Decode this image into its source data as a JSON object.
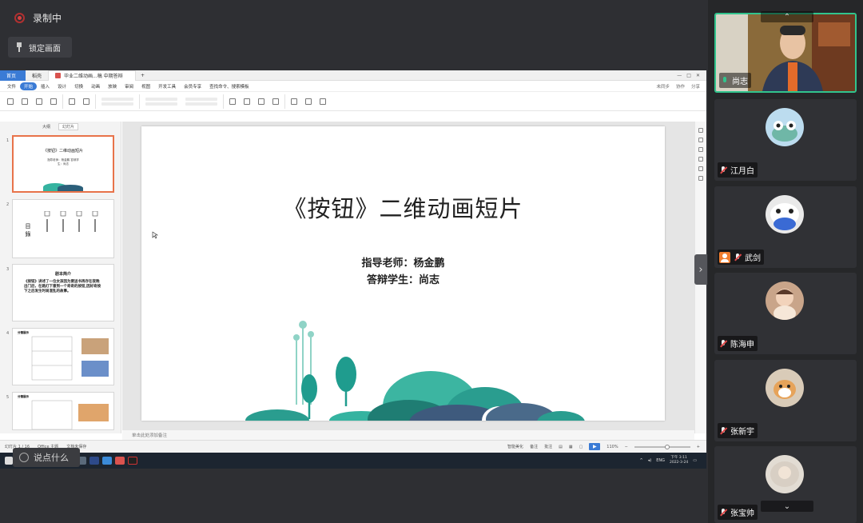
{
  "recording": {
    "status": "录制中",
    "lock_label": "锁定画面"
  },
  "window": {
    "tabs": [
      {
        "label": "首页"
      },
      {
        "label": "稻壳"
      },
      {
        "label": "毕业二维动画...稿 中期答辩"
      }
    ],
    "menu": [
      "文件",
      "开始",
      "插入",
      "设计",
      "切换",
      "动画",
      "放映",
      "审阅",
      "视图",
      "开发工具",
      "会员专享",
      "查找命令、搜索模板"
    ],
    "menu_right": [
      "未同步",
      "协作",
      "分享"
    ],
    "panel_tabs": [
      "大纲",
      "幻灯片"
    ],
    "thumbs": [
      {
        "num": "1",
        "title": "《按钮》二维动画短片",
        "sub": "指导老师：杨金鹏 答辩学生：尚志"
      },
      {
        "num": "2",
        "title": "目 錄"
      },
      {
        "num": "3",
        "title": "剧本简介",
        "body": "《按钮》讲述了一位女孩因为要送书再存在夜晚出门后，在路灯下意到一个奇奇的按钮,因好奇按下之后发生时局混乱的故事。"
      },
      {
        "num": "4",
        "title": "分镜展示"
      },
      {
        "num": "5",
        "title": "分镜展示"
      }
    ],
    "slide": {
      "title": "《按钮》二维动画短片",
      "advisor": "指导老师：杨金鹏",
      "student": "答辩学生：尚志"
    },
    "notes_placeholder": "单击此处添加备注",
    "status": {
      "slide_counter": "幻灯片 1 / 16",
      "theme": "Office 主题",
      "backup": "文档未保存",
      "smart": "智能美化",
      "notes_btn": "备注",
      "comment_btn": "批注",
      "zoom": "110%"
    },
    "taskbar": {
      "time": "下午 3:11",
      "date": "2022-3-24",
      "lang": "ENG"
    }
  },
  "chat_input": {
    "placeholder": "说点什么"
  },
  "participants": [
    {
      "name": "尚志",
      "speaking": true,
      "mic": "on"
    },
    {
      "name": "江月白",
      "mic": "off"
    },
    {
      "name": "武剑",
      "mic": "off"
    },
    {
      "name": "陈海申",
      "mic": "off"
    },
    {
      "name": "张新宇",
      "mic": "off"
    },
    {
      "name": "张宝帅",
      "mic": "off"
    }
  ],
  "colors": {
    "accent_green": "#31c48d",
    "ppt_blue": "#3a7bd5",
    "thumb_sel": "#e8734a"
  }
}
